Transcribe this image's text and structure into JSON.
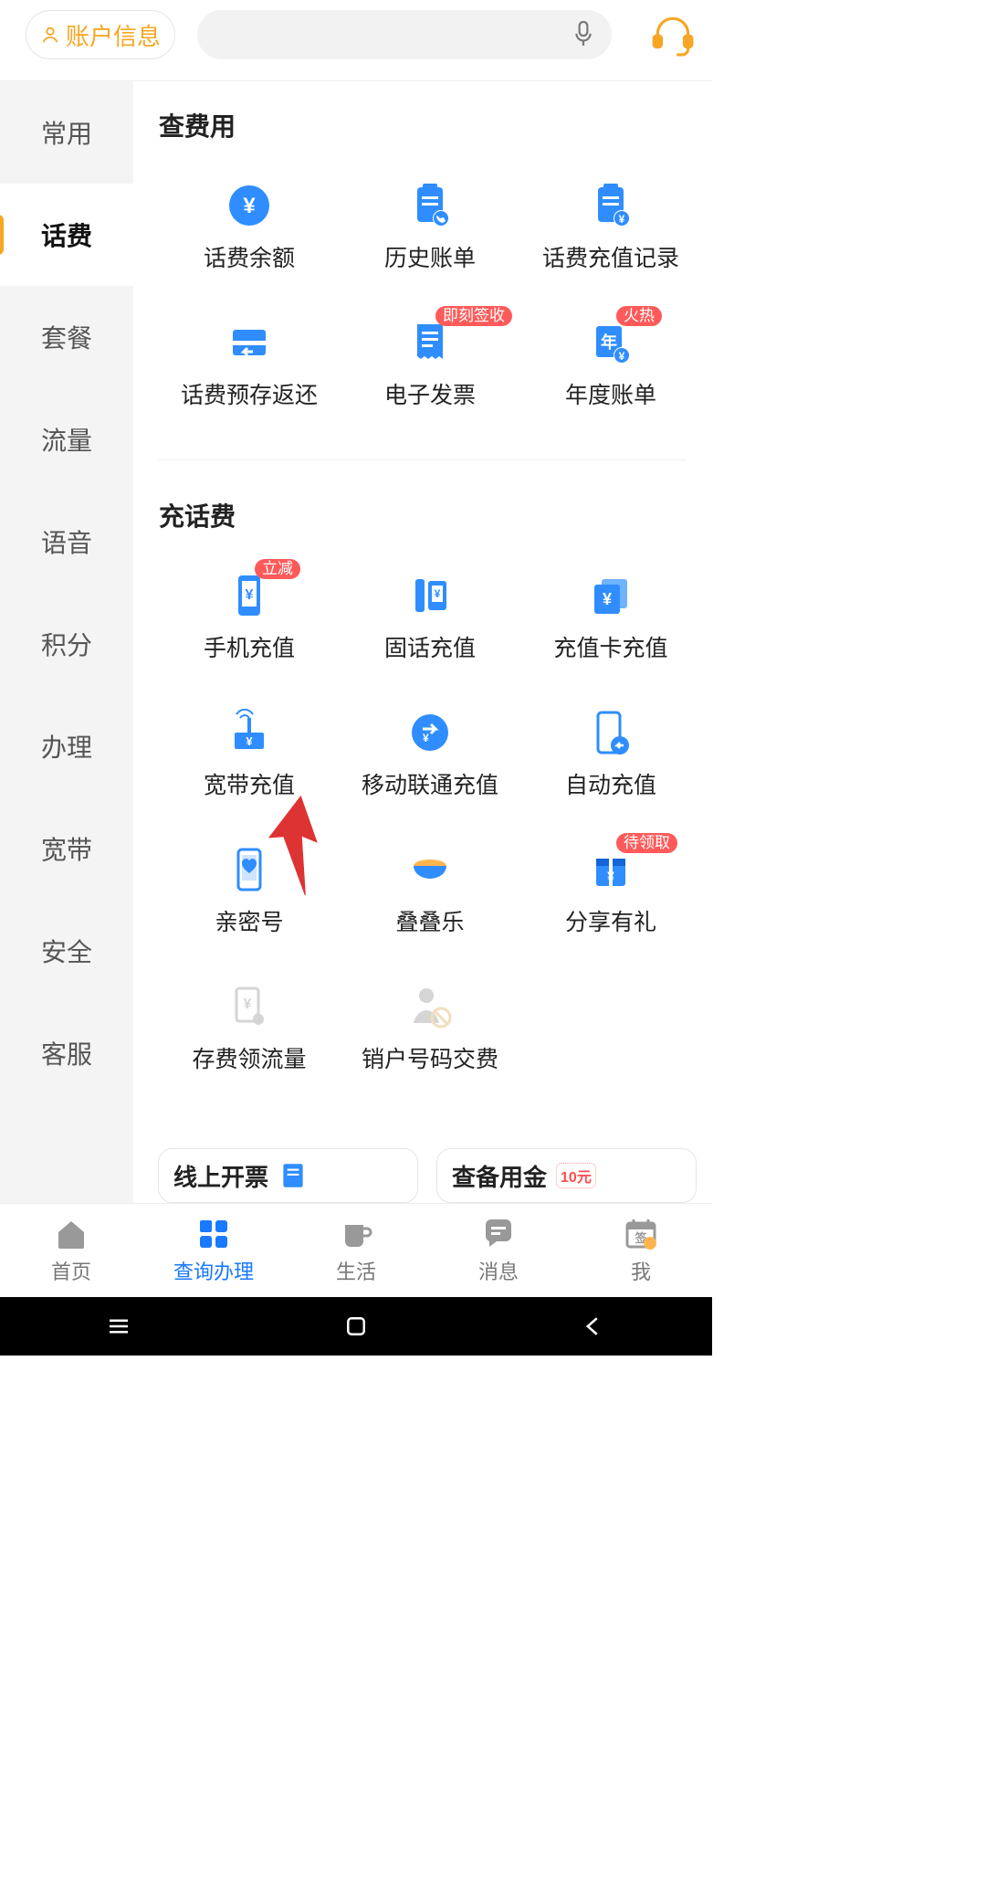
{
  "header": {
    "account_label": "账户信息"
  },
  "sidebar": {
    "items": [
      {
        "label": "常用"
      },
      {
        "label": "话费",
        "active": true
      },
      {
        "label": "套餐"
      },
      {
        "label": "流量"
      },
      {
        "label": "语音"
      },
      {
        "label": "积分"
      },
      {
        "label": "办理"
      },
      {
        "label": "宽带"
      },
      {
        "label": "安全"
      },
      {
        "label": "客服"
      }
    ]
  },
  "sections": [
    {
      "title": "查费用",
      "key": "s0",
      "items": [
        {
          "label": "话费余额",
          "icon": "yen-circle"
        },
        {
          "label": "历史账单",
          "icon": "clipboard-phone"
        },
        {
          "label": "话费充值记录",
          "icon": "clipboard-yen"
        },
        {
          "label": "话费预存返还",
          "icon": "card-return"
        },
        {
          "label": "电子发票",
          "icon": "receipt",
          "badge": "即刻签收"
        },
        {
          "label": "年度账单",
          "icon": "year-bill",
          "badge": "火热"
        }
      ]
    },
    {
      "title": "充话费",
      "key": "s1",
      "items": [
        {
          "label": "手机充值",
          "icon": "phone-yen",
          "badge": "立减"
        },
        {
          "label": "固话充值",
          "icon": "landline"
        },
        {
          "label": "充值卡充值",
          "icon": "cards-yen"
        },
        {
          "label": "宽带充值",
          "icon": "router-yen"
        },
        {
          "label": "移动联通充值",
          "icon": "swap-circle"
        },
        {
          "label": "自动充值",
          "icon": "phone-auto"
        },
        {
          "label": "亲密号",
          "icon": "phone-heart"
        },
        {
          "label": "叠叠乐",
          "icon": "bowl"
        },
        {
          "label": "分享有礼",
          "icon": "gift-yen",
          "badge": "待领取"
        },
        {
          "label": "存费领流量",
          "icon": "yen-water",
          "disabled": true
        },
        {
          "label": "销户号码交费",
          "icon": "person-block",
          "disabled": true
        }
      ]
    }
  ],
  "promos": [
    {
      "title": "线上开票"
    },
    {
      "title": "查备用金",
      "chip": "10元"
    }
  ],
  "tabs": [
    {
      "label": "首页",
      "icon": "home"
    },
    {
      "label": "查询办理",
      "icon": "grid",
      "active": true
    },
    {
      "label": "生活",
      "icon": "cup"
    },
    {
      "label": "消息",
      "icon": "chat"
    },
    {
      "label": "我",
      "icon": "cal"
    }
  ]
}
